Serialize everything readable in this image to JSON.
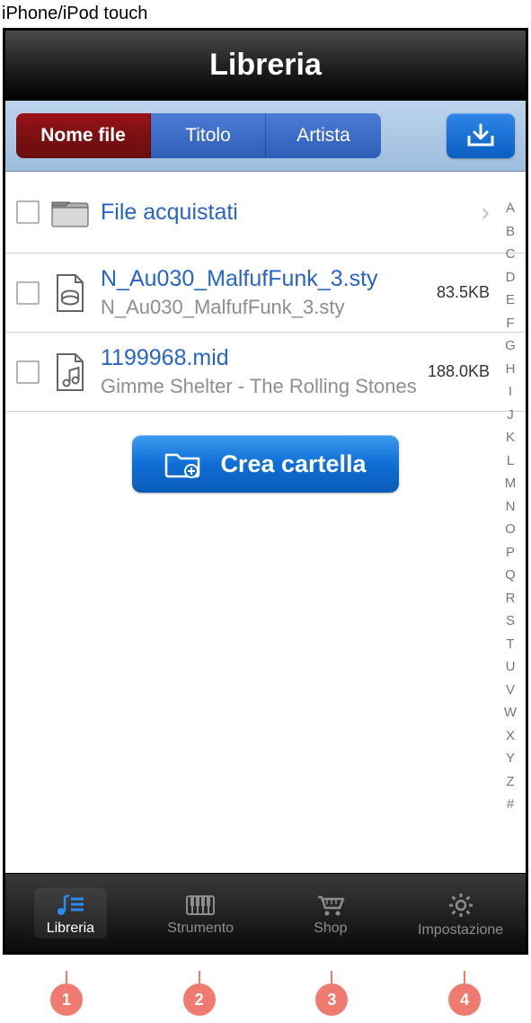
{
  "device_label": "iPhone/iPod touch",
  "title": "Libreria",
  "sort": {
    "opts": [
      "Nome file",
      "Titolo",
      "Artista"
    ],
    "selected": 0
  },
  "rows": {
    "folder": {
      "title": "File acquistati"
    },
    "file1": {
      "title": "N_Au030_MalfufFunk_3.sty",
      "sub": "N_Au030_MalfufFunk_3.sty",
      "size": "83.5KB"
    },
    "file2": {
      "title": "1199968.mid",
      "sub": "Gimme Shelter - The Rolling Stones",
      "size": "188.0KB"
    }
  },
  "create_label": "Crea cartella",
  "index_letters": [
    "A",
    "B",
    "C",
    "D",
    "E",
    "F",
    "G",
    "H",
    "I",
    "J",
    "K",
    "L",
    "M",
    "N",
    "O",
    "P",
    "Q",
    "R",
    "S",
    "T",
    "U",
    "V",
    "W",
    "X",
    "Y",
    "Z",
    "#"
  ],
  "tabs": [
    "Libreria",
    "Strumento",
    "Shop",
    "Impostazione"
  ],
  "markers": [
    "1",
    "2",
    "3",
    "4"
  ]
}
